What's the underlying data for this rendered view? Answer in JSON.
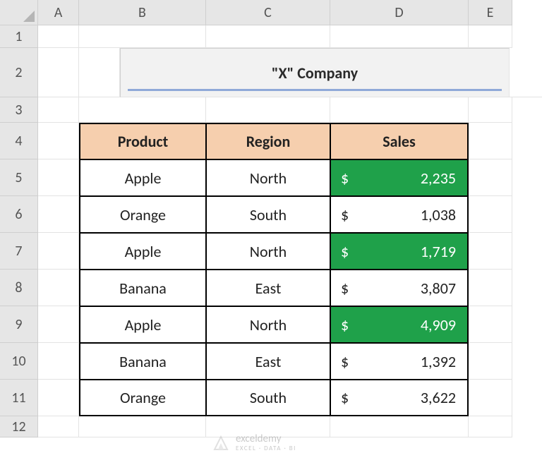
{
  "columns": [
    {
      "label": "A",
      "width": 58
    },
    {
      "label": "B",
      "width": 180
    },
    {
      "label": "C",
      "width": 176
    },
    {
      "label": "D",
      "width": 196
    },
    {
      "label": "E",
      "width": 62
    }
  ],
  "rows": [
    {
      "label": "1",
      "height": 32
    },
    {
      "label": "2",
      "height": 70
    },
    {
      "label": "3",
      "height": 36
    },
    {
      "label": "4",
      "height": 52
    },
    {
      "label": "5",
      "height": 52
    },
    {
      "label": "6",
      "height": 52
    },
    {
      "label": "7",
      "height": 52
    },
    {
      "label": "8",
      "height": 52
    },
    {
      "label": "9",
      "height": 52
    },
    {
      "label": "10",
      "height": 52
    },
    {
      "label": "11",
      "height": 52
    },
    {
      "label": "12",
      "height": 30
    }
  ],
  "title": "\"X\" Company",
  "headers": {
    "product": "Product",
    "region": "Region",
    "sales": "Sales"
  },
  "currency": "$",
  "data": [
    {
      "product": "Apple",
      "region": "North",
      "sales": "2,235",
      "highlight": true
    },
    {
      "product": "Orange",
      "region": "South",
      "sales": "1,038",
      "highlight": false
    },
    {
      "product": "Apple",
      "region": "North",
      "sales": "1,719",
      "highlight": true
    },
    {
      "product": "Banana",
      "region": "East",
      "sales": "3,807",
      "highlight": false
    },
    {
      "product": "Apple",
      "region": "North",
      "sales": "4,909",
      "highlight": true
    },
    {
      "product": "Banana",
      "region": "East",
      "sales": "1,392",
      "highlight": false
    },
    {
      "product": "Orange",
      "region": "South",
      "sales": "3,622",
      "highlight": false
    }
  ],
  "watermark": {
    "brand": "exceldemy",
    "sub": "EXCEL · DATA · BI"
  },
  "colors": {
    "headerFill": "#f6cfae",
    "highlightFill": "#1fa14a",
    "titleFill": "#f2f2f2",
    "accentLine": "#8fa9d8"
  },
  "chart_data": {
    "type": "table",
    "title": "\"X\" Company",
    "columns": [
      "Product",
      "Region",
      "Sales"
    ],
    "rows": [
      [
        "Apple",
        "North",
        2235
      ],
      [
        "Orange",
        "South",
        1038
      ],
      [
        "Apple",
        "North",
        1719
      ],
      [
        "Banana",
        "East",
        3807
      ],
      [
        "Apple",
        "North",
        4909
      ],
      [
        "Banana",
        "East",
        1392
      ],
      [
        "Orange",
        "South",
        3622
      ]
    ]
  }
}
